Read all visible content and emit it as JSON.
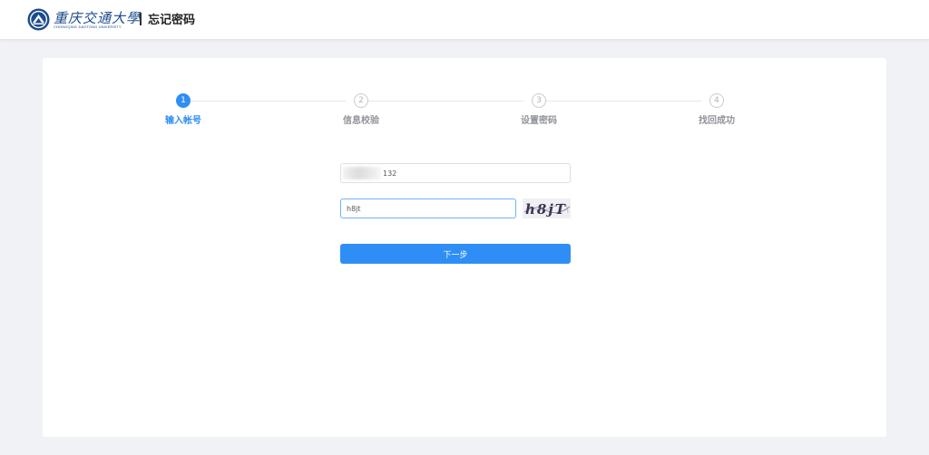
{
  "header": {
    "logo_text_cn": "重庆交通大學",
    "logo_text_en": "CHONGQING JIAOTONG UNIVERSITY",
    "page_title": "忘记密码"
  },
  "steps": [
    {
      "number": "1",
      "label": "输入帐号",
      "state": "active"
    },
    {
      "number": "2",
      "label": "信息校验",
      "state": "inactive"
    },
    {
      "number": "3",
      "label": "设置密码",
      "state": "inactive"
    },
    {
      "number": "4",
      "label": "找回成功",
      "state": "inactive"
    }
  ],
  "form": {
    "account_value": "132",
    "captcha_value": "h8jt",
    "captcha_image_text": "h8jT",
    "next_label": "下一步"
  },
  "colors": {
    "primary": "#2f8ef5",
    "inactive": "#909399",
    "page_bg": "#f0f2f5",
    "brand": "#1c4b8c"
  },
  "icons": [
    "university-seal-icon"
  ]
}
